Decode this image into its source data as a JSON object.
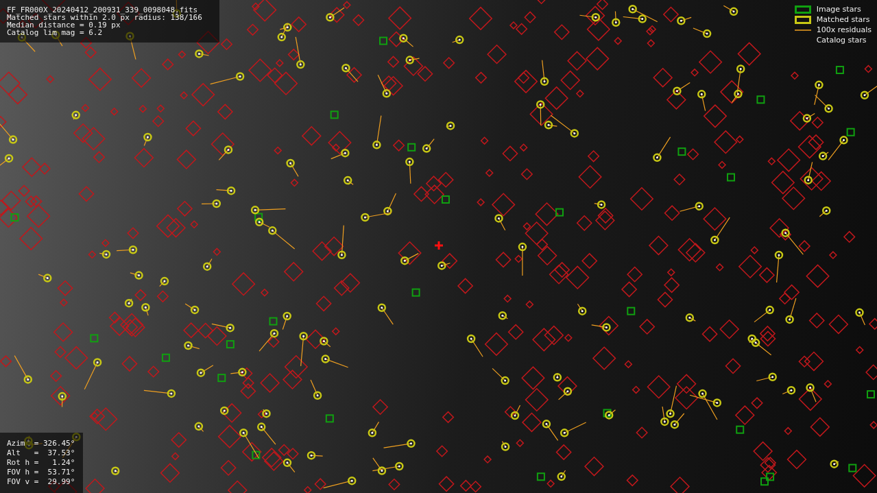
{
  "header_info": {
    "lines": [
      "FF_FR000X_20240412_200931_339_0098048.fits",
      "Matched stars within 2.0 px radius: 138/166",
      "Median distance = 0.19 px",
      "Catalog lim mag = 6.2"
    ]
  },
  "legend": [
    {
      "kind": "image",
      "label": "Image stars"
    },
    {
      "kind": "matched",
      "label": "Matched stars"
    },
    {
      "kind": "residual",
      "label": "100x residuals"
    },
    {
      "kind": "catalog",
      "label": "Catalog stars"
    }
  ],
  "pointing_info": {
    "lines": [
      "Azim  = 326.45°",
      "Alt   =  37.53°",
      "Rot h =   1.24°",
      "FOV h =  53.71°",
      "FOV v =  29.99°"
    ]
  }
}
